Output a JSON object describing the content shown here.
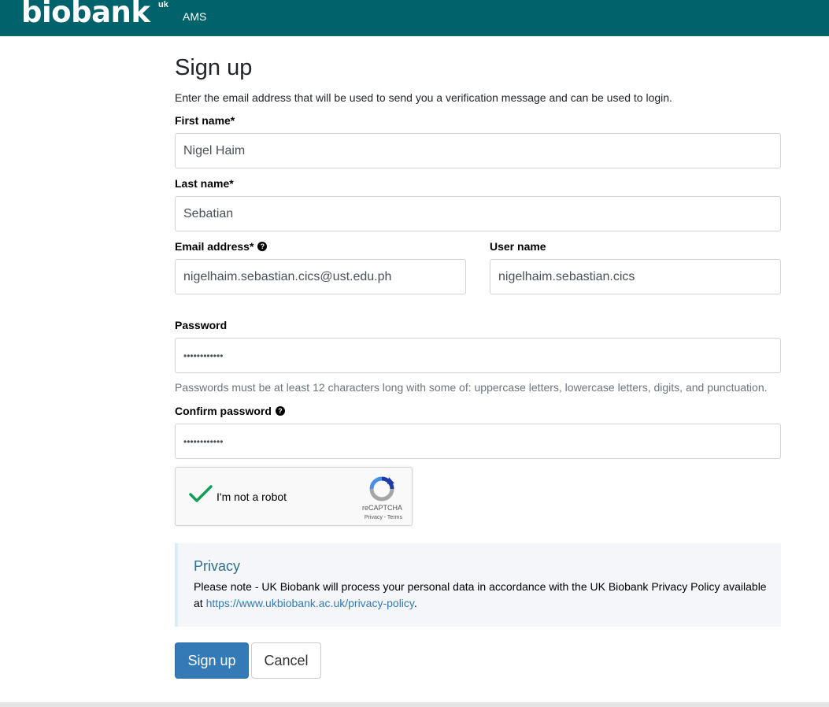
{
  "header": {
    "logo_text": "biobank",
    "logo_sup": "uk",
    "app_name": "AMS",
    "background_color": "#00626b"
  },
  "form": {
    "title": "Sign up",
    "intro": "Enter the email address that will be used to send you a verification message and can be used to login.",
    "first_name": {
      "label": "First name*",
      "value": "Nigel Haim"
    },
    "last_name": {
      "label": "Last name*",
      "value": "Sebatian"
    },
    "email": {
      "label": "Email address*",
      "value": "nigelhaim.sebastian.cics@ust.edu.ph",
      "help_icon": "question-circle-icon"
    },
    "username": {
      "label": "User name",
      "value": "nigelhaim.sebastian.cics"
    },
    "password": {
      "label": "Password",
      "value": "••••••••••••",
      "hint": "Passwords must be at least 12 characters long with some of: uppercase letters, lowercase letters, digits, and punctuation."
    },
    "confirm_password": {
      "label": "Confirm password",
      "value": "••••••••••••",
      "help_icon": "question-circle-icon"
    }
  },
  "captcha": {
    "label": "I'm not a robot",
    "checked": true,
    "brand": "reCAPTCHA",
    "links": "Privacy - Terms"
  },
  "privacy": {
    "title": "Privacy",
    "text": "Please note - UK Biobank will process your personal data in accordance with the UK Biobank Privacy Policy available at ",
    "link": "https://www.ukbiobank.ac.uk/privacy-policy",
    "suffix": "."
  },
  "buttons": {
    "submit": "Sign up",
    "cancel": "Cancel",
    "primary_color": "#337ab7"
  }
}
